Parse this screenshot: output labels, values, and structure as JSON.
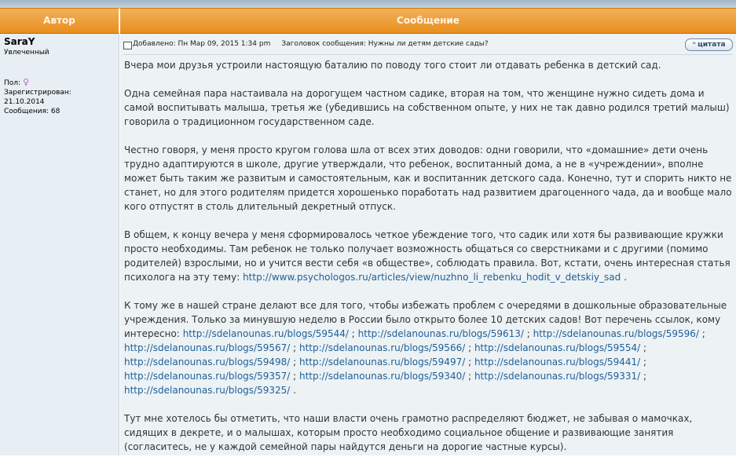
{
  "header": {
    "author_label": "Автор",
    "message_label": "Сообщение"
  },
  "author": {
    "name": "SaraY",
    "rank": "Увлеченный",
    "gender_label": "Пол:",
    "registered_label": "Зарегистрирован:",
    "registered_date": "21.10.2014",
    "posts_label": "Сообщения:",
    "posts_count": "68",
    "gender_icon": "female-icon"
  },
  "post": {
    "added": "Добавлено: Пн Мар 09, 2015 1:34 pm",
    "subject": "Заголовок сообщения: Нужны ли детям детские сады?",
    "quote_label": "цитата",
    "p1": "Вчера мои друзья устроили настоящую баталию по поводу того стоит ли отдавать ребенка в детский сад.",
    "p2": "Одна семейная пара настаивала на дорогущем частном садике, вторая на том, что женщине нужно сидеть дома и самой воспитывать малыша, третья же (убедившись на собственном опыте, у них не так давно родился третий малыш) говорила о традиционном государственном саде.",
    "p3": "Честно говоря, у меня просто кругом голова шла от всех этих доводов: одни говорили, что «домашние» дети очень трудно адаптируются в школе, другие утверждали, что ребенок, воспитанный дома, а не в «учреждении», вполне может быть таким же развитым и самостоятельным, как и воспитанник детского сада. Конечно, тут и спорить никто не станет, но для этого родителям придется хорошенько поработать над развитием драгоценного чада, да и вообще мало кого отпустят в столь длительный декретный отпуск.",
    "p4_text": "В общем, к концу вечера у меня сформировалось четкое убеждение того, что садик или хотя бы развивающие кружки просто необходимы. Там ребенок не только получает возможность общаться со сверстниками и с другими (помимо родителей) взрослыми, но и учится вести себя «в обществе», соблюдать правила. Вот, кстати, очень интересная статья психолога на эту тему:",
    "p4_link": "http://www.psychologos.ru/articles/view/nuzhno_li_rebenku_hodit_v_detskiy_sad",
    "p4_end": ".",
    "p5_text": "К тому же в нашей стране делают все для того, чтобы избежать проблем с очередями в дошкольные образовательные учреждения. Только за минувшую неделю в России было открыто более 10 детских садов! Вот перечень ссылок, кому интересно:",
    "links": [
      "http://sdelanounas.ru/blogs/59544/",
      "http://sdelanounas.ru/blogs/59613/",
      "http://sdelanounas.ru/blogs/59596/",
      "http://sdelanounas.ru/blogs/59567/",
      "http://sdelanounas.ru/blogs/59566/",
      "http://sdelanounas.ru/blogs/59554/",
      "http://sdelanounas.ru/blogs/59498/",
      "http://sdelanounas.ru/blogs/59497/",
      "http://sdelanounas.ru/blogs/59441/",
      "http://sdelanounas.ru/blogs/59357/",
      "http://sdelanounas.ru/blogs/59340/",
      "http://sdelanounas.ru/blogs/59331/",
      "http://sdelanounas.ru/blogs/59325/"
    ],
    "p6": "Тут мне хотелось бы отметить, что наши власти очень грамотно распределяют бюджет, не забывая о мамочках, сидящих в декрете, и о малышах, которым просто необходимо социальное общение и развивающие занятия (согласитесь, не у каждой семейной пары найдутся деньги на дорогие частные курсы)."
  }
}
